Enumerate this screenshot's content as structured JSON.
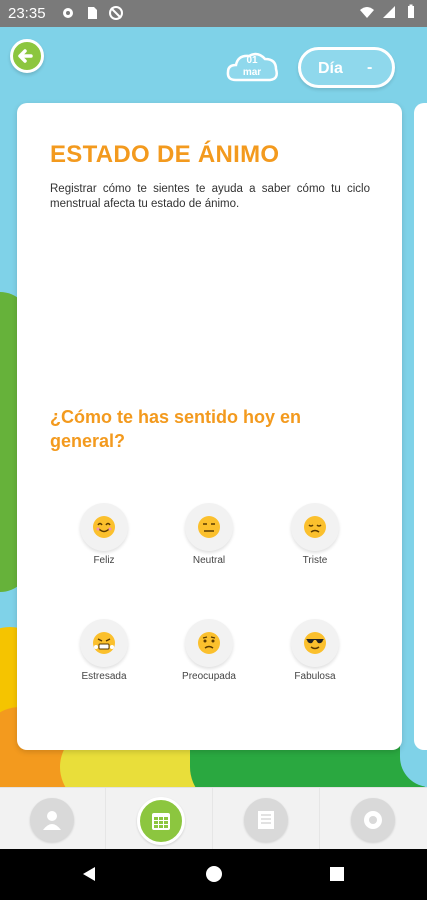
{
  "status_bar": {
    "time": "23:35",
    "left_icons": [
      "gear-icon",
      "sd-card-icon",
      "no-sync-icon"
    ],
    "right_icons": [
      "wifi-icon",
      "signal-icon",
      "battery-icon"
    ]
  },
  "header": {
    "date": {
      "day": "01",
      "month": "mar"
    },
    "view_toggle": {
      "label": "Día",
      "control": "-"
    }
  },
  "card": {
    "title": "ESTADO DE ÁNIMO",
    "description": "Registrar cómo te sientes te ayuda a saber cómo tu ciclo menstrual afecta tu estado de ánimo.",
    "question": "¿Cómo te has sentido hoy en general?",
    "moods": [
      {
        "label": "Feliz",
        "icon": "happy-face-icon"
      },
      {
        "label": "Neutral",
        "icon": "neutral-face-icon"
      },
      {
        "label": "Triste",
        "icon": "sad-face-icon"
      },
      {
        "label": "Estresada",
        "icon": "stressed-face-icon"
      },
      {
        "label": "Preocupada",
        "icon": "worried-face-icon"
      },
      {
        "label": "Fabulosa",
        "icon": "sunglasses-face-icon"
      }
    ]
  },
  "bottom_nav": [
    "profile-icon",
    "calendar-icon",
    "notes-icon",
    "settings-icon"
  ],
  "colors": {
    "accent": "#f39a1e",
    "green": "#8cc63f",
    "sky": "#7fd2e8"
  }
}
